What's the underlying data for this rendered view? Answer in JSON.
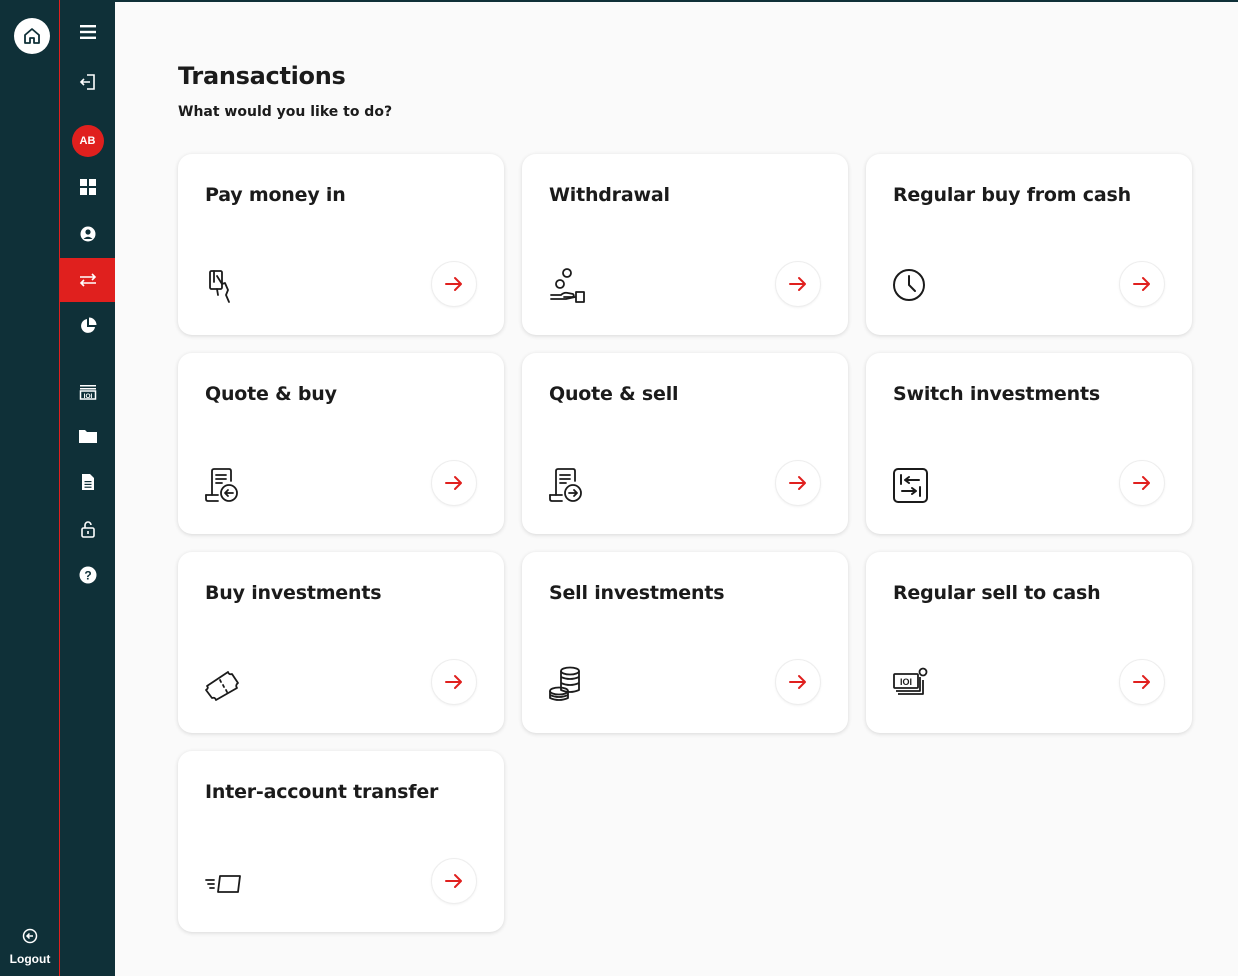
{
  "header": {
    "title": "Transactions",
    "subtitle": "What would you like to do?"
  },
  "user": {
    "initials": "AB"
  },
  "rail": {
    "logout_label": "Logout"
  },
  "nav": {
    "items": [
      {
        "icon": "menu-icon"
      },
      {
        "icon": "sign-in-icon"
      },
      {
        "icon": "avatar"
      },
      {
        "icon": "dashboard-icon"
      },
      {
        "icon": "profile-icon"
      },
      {
        "icon": "transactions-icon",
        "active": true
      },
      {
        "icon": "pie-chart-icon"
      },
      {
        "icon": "cash-icon"
      },
      {
        "icon": "folder-icon"
      },
      {
        "icon": "document-icon"
      },
      {
        "icon": "unlock-icon"
      },
      {
        "icon": "help-icon"
      }
    ]
  },
  "cards": [
    {
      "title": "Pay money in",
      "icon": "card-payment-icon"
    },
    {
      "title": "Withdrawal",
      "icon": "withdrawal-hand-icon"
    },
    {
      "title": "Regular buy from cash",
      "icon": "clock-icon"
    },
    {
      "title": "Quote & buy",
      "icon": "quote-buy-icon"
    },
    {
      "title": "Quote & sell",
      "icon": "quote-sell-icon"
    },
    {
      "title": "Switch investments",
      "icon": "switch-icon"
    },
    {
      "title": "Buy investments",
      "icon": "ticket-icon"
    },
    {
      "title": "Sell investments",
      "icon": "coin-stack-icon"
    },
    {
      "title": "Regular sell to cash",
      "icon": "cash-stack-icon"
    },
    {
      "title": "Inter-account transfer",
      "icon": "fast-transfer-icon"
    }
  ],
  "colors": {
    "rail": "#0f3038",
    "accent": "#e0201e",
    "text": "#1b1b1b"
  }
}
